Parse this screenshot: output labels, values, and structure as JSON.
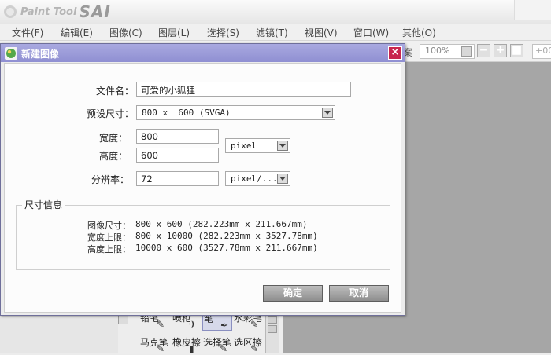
{
  "app": {
    "logo_text_paint": "Paint Tool",
    "logo_text_sai": "SAI"
  },
  "menubar": {
    "items": [
      "文件(F)",
      "编辑(E)",
      "图像(C)",
      "图层(L)",
      "选择(S)",
      "滤镜(T)",
      "视图(V)",
      "窗口(W)",
      "其他(O)"
    ]
  },
  "toolbar": {
    "fragment": "案",
    "zoom_value": "100%",
    "angle_value": "+00"
  },
  "tools": [
    {
      "name": "铅笔",
      "icon": "✎"
    },
    {
      "name": "喷枪",
      "icon": "✈"
    },
    {
      "name": "笔",
      "icon": "✒",
      "selected": true
    },
    {
      "name": "水彩笔",
      "icon": "✎"
    },
    {
      "name": "马克笔",
      "icon": "✎"
    },
    {
      "name": "橡皮擦",
      "icon": "▮"
    },
    {
      "name": "选择笔",
      "icon": "✎"
    },
    {
      "name": "选区擦",
      "icon": "✎"
    }
  ],
  "dialog": {
    "title": "新建图像",
    "close_glyph": "×",
    "filename_label": "文件名：",
    "filename_value": "可爱的小狐狸",
    "preset_label": "预设尺寸：",
    "preset_value": "800 x  600 (SVGA)",
    "width_label": "宽度：",
    "width_value": "800",
    "height_label": "高度：",
    "height_value": "600",
    "unit_value": "pixel",
    "resolution_label": "分辨率：",
    "resolution_value": "72",
    "resolution_unit": "pixel/...",
    "info_group_title": "尺寸信息",
    "info": [
      {
        "label": "图像尺寸：",
        "value": "800 x 600 (282.223mm x 211.667mm)"
      },
      {
        "label": "宽度上限：",
        "value": "800 x 10000 (282.223mm x 3527.78mm)"
      },
      {
        "label": "高度上限：",
        "value": "10000 x 600 (3527.78mm x 211.667mm)"
      }
    ],
    "ok_label": "确定",
    "cancel_label": "取消"
  },
  "colors": {
    "dialog_title_bar": "#9999d8",
    "close_button": "#c8254e",
    "canvas_bg": "#a6a6a6"
  }
}
